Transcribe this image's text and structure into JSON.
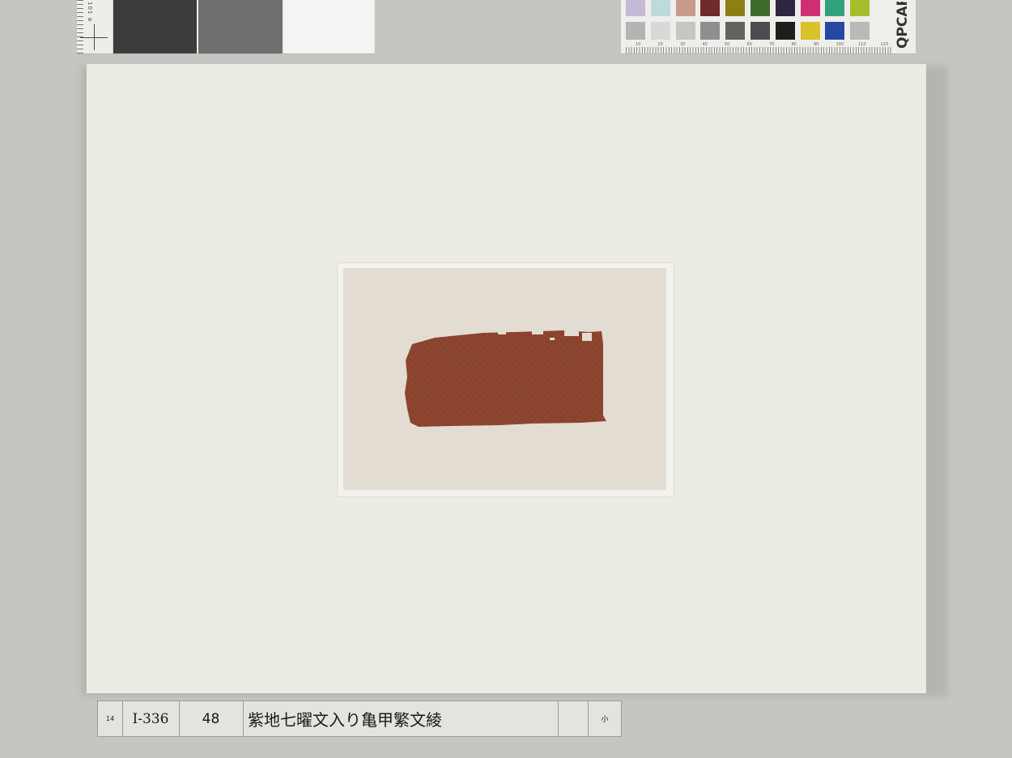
{
  "gray_card": {
    "ruler_text": "101 α",
    "patches": [
      {
        "color": "#3b3b3e"
      },
      {
        "color": "#6f6f72"
      },
      {
        "color": "#f4f4f2"
      }
    ]
  },
  "color_checker": {
    "brand": "QPCARD",
    "scale_numbers": [
      "10",
      "20",
      "30",
      "40",
      "50",
      "60",
      "70",
      "80",
      "90",
      "100",
      "110",
      "120"
    ],
    "row1": [
      "#c5b9d8",
      "#bfdadb",
      "#c99a8c",
      "#6e2b2c",
      "#8b7f16",
      "#3e6b2c",
      "#2e2643",
      "#cf2f74",
      "#33a17c",
      "#a7bd2a"
    ],
    "row2": [
      "#b4b4b4",
      "#d8d8d8",
      "#c6c6c6",
      "#8f8f8f",
      "#626262",
      "#4c4c4e",
      "#1e1e1e",
      "#d9c22a",
      "#2448a4",
      "#b9b9b9"
    ]
  },
  "specimen": {
    "textile_color": "#8e4630",
    "mat_color": "#e3dcd3"
  },
  "label": {
    "number": "14",
    "catalog_id": "I-336",
    "item_no": "48",
    "title": "紫地七曜文入り亀甲繁文綾",
    "size": "小"
  }
}
